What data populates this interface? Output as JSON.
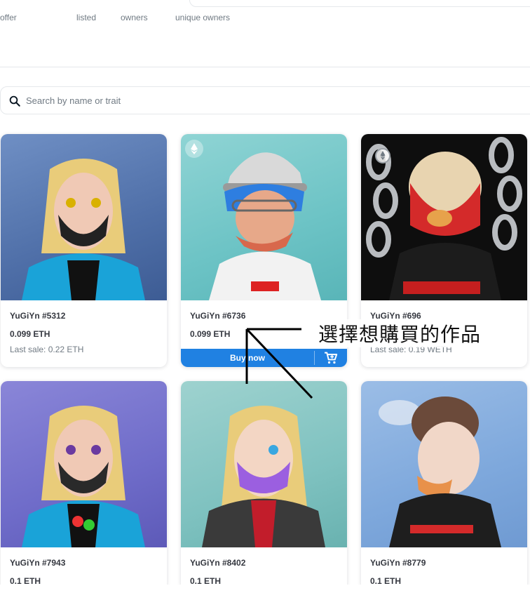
{
  "stats": {
    "labels": [
      "offer",
      "listed",
      "owners",
      "unique owners"
    ]
  },
  "search": {
    "placeholder": "Search by name or trait",
    "icon": "search-icon"
  },
  "items": [
    {
      "name": "YuGiYn #5312",
      "price": "0.099 ETH",
      "last_sale": "Last sale: 0.22 ETH"
    },
    {
      "name": "YuGiYn #6736",
      "price": "0.099 ETH",
      "last_sale": "",
      "buy_label": "Buy now",
      "badge": "eth-icon"
    },
    {
      "name": "YuGiYn #696",
      "price": "",
      "last_sale": "Last sale: 0.19 WETH",
      "badge": "weth-icon"
    },
    {
      "name": "YuGiYn #7943",
      "price": "0.1 ETH",
      "last_sale": ""
    },
    {
      "name": "YuGiYn #8402",
      "price": "0.1 ETH",
      "last_sale": ""
    },
    {
      "name": "YuGiYn #8779",
      "price": "0.1 ETH",
      "last_sale": ""
    }
  ],
  "annotation": {
    "text": "選擇想購買的作品"
  },
  "colors": {
    "accent": "#2081e2",
    "text_primary": "#353840",
    "text_secondary": "#707a83"
  }
}
